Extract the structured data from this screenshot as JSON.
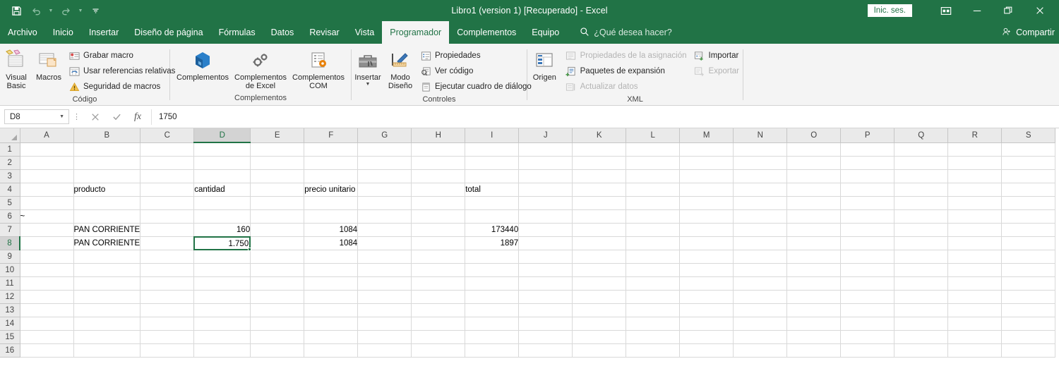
{
  "titlebar": {
    "document_title": "Libro1 (version 1) [Recuperado]  -  Excel",
    "quick_access": [
      {
        "name": "save-icon",
        "label": "Guardar"
      },
      {
        "name": "undo-icon",
        "label": "Deshacer"
      },
      {
        "name": "redo-icon",
        "label": "Rehacer"
      },
      {
        "name": "customize-qat-icon",
        "label": "Personalizar barra de herramientas de acceso rapido"
      }
    ],
    "sign_in_label": "Inic. ses.",
    "window_buttons": [
      {
        "name": "ribbon-display-options-icon",
        "label": "Opciones de presentacion de la cinta"
      },
      {
        "name": "minimize-icon",
        "label": "Minimizar"
      },
      {
        "name": "restore-icon",
        "label": "Restaurar"
      },
      {
        "name": "close-icon",
        "label": "Cerrar"
      }
    ],
    "share_label": "Compartir",
    "accent_color": "#217346"
  },
  "tabs": [
    {
      "label": "Archivo",
      "active": false
    },
    {
      "label": "Inicio",
      "active": false
    },
    {
      "label": "Insertar",
      "active": false
    },
    {
      "label": "Diseño de página",
      "active": false
    },
    {
      "label": "Fórmulas",
      "active": false
    },
    {
      "label": "Datos",
      "active": false
    },
    {
      "label": "Revisar",
      "active": false
    },
    {
      "label": "Vista",
      "active": false
    },
    {
      "label": "Programador",
      "active": true
    },
    {
      "label": "Complementos",
      "active": false
    },
    {
      "label": "Equipo",
      "active": false
    }
  ],
  "tell_me": {
    "icon": "search-icon",
    "placeholder": "¿Qué desea hacer?"
  },
  "ribbon": {
    "groups": [
      {
        "label": "Código",
        "big_buttons": [
          {
            "name": "visual-basic-button",
            "line1": "Visual",
            "line2": "Basic"
          },
          {
            "name": "macros-button",
            "line1": "Macros",
            "line2": ""
          }
        ],
        "small_buttons": [
          {
            "name": "record-macro-button",
            "label": "Grabar macro",
            "disabled": false
          },
          {
            "name": "use-relative-references-button",
            "label": "Usar referencias relativas",
            "disabled": false
          },
          {
            "name": "macro-security-button",
            "label": "Seguridad de macros",
            "disabled": false
          }
        ]
      },
      {
        "label": "Complementos",
        "big_buttons": [
          {
            "name": "add-ins-button",
            "line1": "Complementos",
            "line2": ""
          },
          {
            "name": "excel-add-ins-button",
            "line1": "Complementos",
            "line2": "de Excel"
          },
          {
            "name": "com-add-ins-button",
            "line1": "Complementos",
            "line2": "COM"
          }
        ],
        "small_buttons": []
      },
      {
        "label": "Controles",
        "big_buttons": [
          {
            "name": "insert-control-button",
            "line1": "Insertar",
            "line2": ""
          },
          {
            "name": "design-mode-button",
            "line1": "Modo",
            "line2": "Diseño"
          }
        ],
        "small_buttons": [
          {
            "name": "properties-button",
            "label": "Propiedades",
            "disabled": false
          },
          {
            "name": "view-code-button",
            "label": "Ver código",
            "disabled": false
          },
          {
            "name": "run-dialog-button",
            "label": "Ejecutar cuadro de diálogo",
            "disabled": false
          }
        ]
      },
      {
        "label": "XML",
        "big_buttons": [
          {
            "name": "source-button",
            "line1": "Origen",
            "line2": ""
          }
        ],
        "small_buttons": [
          {
            "name": "map-properties-button",
            "label": "Propiedades de la asignación",
            "disabled": true
          },
          {
            "name": "expansion-packs-button",
            "label": "Paquetes de expansión",
            "disabled": false
          },
          {
            "name": "refresh-data-button",
            "label": "Actualizar datos",
            "disabled": true
          },
          {
            "name": "import-button",
            "label": "Importar",
            "disabled": false
          },
          {
            "name": "export-button",
            "label": "Exportar",
            "disabled": true
          }
        ]
      }
    ]
  },
  "formula_bar": {
    "name_box_value": "D8",
    "cancel_label": "Cancelar",
    "enter_label": "Introducir",
    "fx_label": "Insertar función",
    "formula_value": "1750"
  },
  "sheet": {
    "columns": [
      "A",
      "B",
      "C",
      "D",
      "E",
      "F",
      "G",
      "H",
      "I",
      "J",
      "K",
      "L",
      "M",
      "N",
      "O",
      "P",
      "Q",
      "R",
      "S"
    ],
    "selected_column": "D",
    "rows": [
      "1",
      "2",
      "3",
      "4",
      "5",
      "6",
      "7",
      "8",
      "9",
      "10",
      "11",
      "12",
      "13",
      "14",
      "15",
      "16"
    ],
    "selected_row": "8",
    "active_cell": "D8",
    "active_cell_display": "1.750",
    "cells": {
      "B4": "producto",
      "D4": "cantidad",
      "F4": "precio unitario",
      "I4": "total",
      "A6": "~",
      "B7": "PAN CORRIENTE",
      "D7": "160",
      "F7": "1084",
      "I7": "173440",
      "B8": "PAN CORRIENTE",
      "F8": "1084",
      "I8": "1897"
    }
  }
}
